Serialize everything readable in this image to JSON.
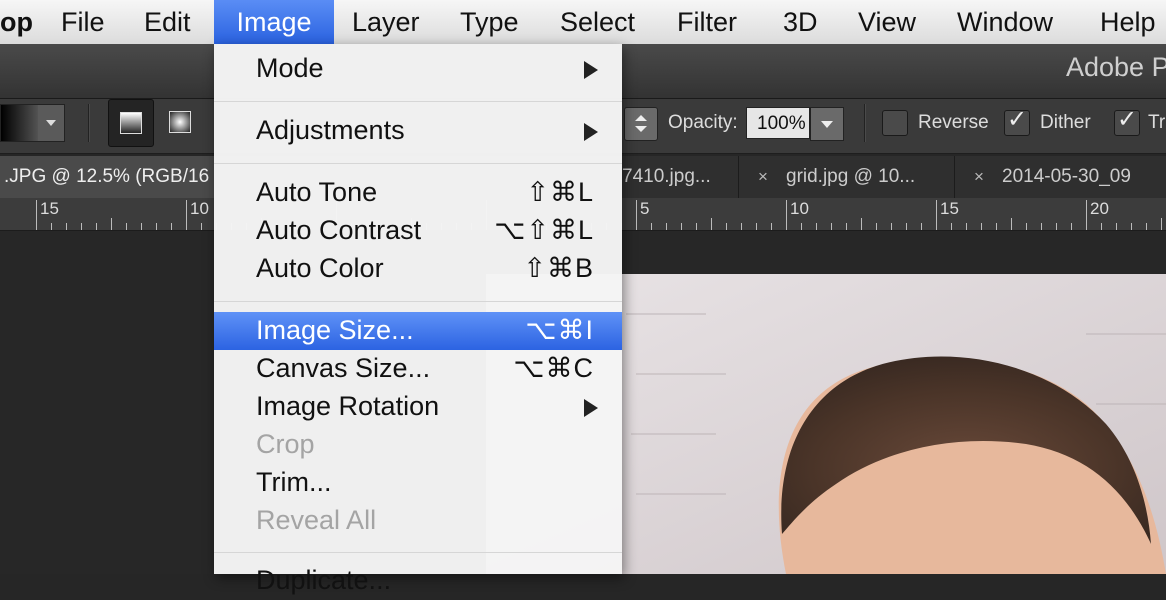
{
  "menubar": {
    "items": [
      {
        "label": "op"
      },
      {
        "label": "File"
      },
      {
        "label": "Edit"
      },
      {
        "label": "Image"
      },
      {
        "label": "Layer"
      },
      {
        "label": "Type"
      },
      {
        "label": "Select"
      },
      {
        "label": "Filter"
      },
      {
        "label": "3D"
      },
      {
        "label": "View"
      },
      {
        "label": "Window"
      },
      {
        "label": "Help"
      }
    ]
  },
  "window": {
    "title": "Adobe P"
  },
  "options": {
    "opacity_label": "Opacity:",
    "opacity_value": "100%",
    "reverse_label": "Reverse",
    "reverse_checked": false,
    "dither_label": "Dither",
    "dither_checked": true,
    "transparency_label": "Tr",
    "transparency_checked": true,
    "check_glyph": "✓"
  },
  "tabs": [
    {
      "label": ".JPG @ 12.5% (RGB/16"
    },
    {
      "label": "7410.jpg..."
    },
    {
      "label": "grid.jpg @ 10..."
    },
    {
      "label": "2014-05-30_09"
    }
  ],
  "tab_close_glyph": "×",
  "ruler": {
    "labels": [
      "15",
      "10",
      "5",
      "10",
      "15",
      "20"
    ]
  },
  "image_menu": {
    "items": [
      {
        "label": "Mode",
        "shortcut": "",
        "submenu": true,
        "enabled": true
      },
      {
        "label": "Adjustments",
        "shortcut": "",
        "submenu": true,
        "enabled": true
      },
      {
        "label": "Auto Tone",
        "shortcut": "⇧⌘L",
        "submenu": false,
        "enabled": true
      },
      {
        "label": "Auto Contrast",
        "shortcut": "⌥⇧⌘L",
        "submenu": false,
        "enabled": true
      },
      {
        "label": "Auto Color",
        "shortcut": "⇧⌘B",
        "submenu": false,
        "enabled": true
      },
      {
        "label": "Image Size...",
        "shortcut": "⌥⌘I",
        "submenu": false,
        "enabled": true,
        "highlighted": true
      },
      {
        "label": "Canvas Size...",
        "shortcut": "⌥⌘C",
        "submenu": false,
        "enabled": true
      },
      {
        "label": "Image Rotation",
        "shortcut": "",
        "submenu": true,
        "enabled": true
      },
      {
        "label": "Crop",
        "shortcut": "",
        "submenu": false,
        "enabled": false
      },
      {
        "label": "Trim...",
        "shortcut": "",
        "submenu": false,
        "enabled": true
      },
      {
        "label": "Reveal All",
        "shortcut": "",
        "submenu": false,
        "enabled": false
      },
      {
        "label": "Duplicate...",
        "shortcut": "",
        "submenu": false,
        "enabled": true
      }
    ]
  },
  "colors": {
    "menu_highlight": "#3a72ec",
    "menu_bg": "#f4f4f4",
    "disabled_text": "#a4a4a4"
  }
}
